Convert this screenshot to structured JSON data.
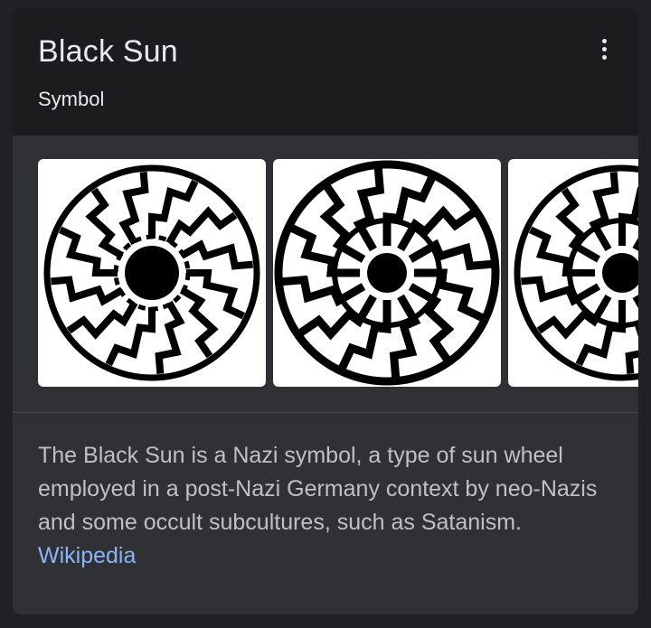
{
  "card": {
    "title": "Black Sun",
    "subtitle": "Symbol",
    "menu_icon": "more-vert-icon"
  },
  "images": [
    {
      "icon": "black-sun-symbol-image"
    },
    {
      "icon": "black-sun-symbol-image"
    },
    {
      "icon": "black-sun-symbol-image"
    }
  ],
  "description": {
    "text": "The Black Sun is a Nazi symbol, a type of sun wheel employed in a post-Nazi Germany context by neo-Nazis and some occult subcultures, such as Satanism.",
    "source_link": "Wikipedia"
  },
  "colors": {
    "page_background": "#202124",
    "card_background": "#303134",
    "header_background": "#1b1c1e",
    "text_primary": "#e8eaed",
    "text_secondary": "#bdc1c6",
    "link": "#8ab4f8"
  }
}
